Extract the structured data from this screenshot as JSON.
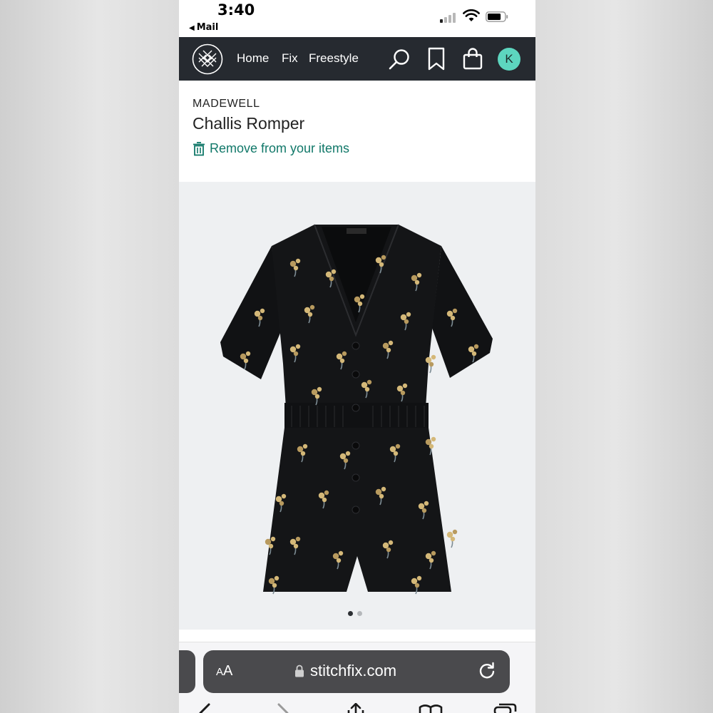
{
  "status_bar": {
    "time": "3:40",
    "back_app": "Mail",
    "cellular_bars_on": 1,
    "cellular_bars_total": 4,
    "battery_level": 0.8
  },
  "nav": {
    "logo_icon": "stitchfix-logo-icon",
    "links": [
      "Home",
      "Fix",
      "Freestyle"
    ],
    "icons": [
      "search-icon",
      "bookmark-icon",
      "bag-icon"
    ],
    "avatar_initial": "K",
    "background_color": "#262a30",
    "avatar_color": "#5dd6bf"
  },
  "product": {
    "brand": "MADEWELL",
    "name": "Challis Romper",
    "remove_label": "Remove from your items",
    "remove_icon": "trash-icon",
    "accent_color": "#117869",
    "image_icon": "romper-product-image",
    "carousel": {
      "current": 1,
      "total": 2
    }
  },
  "browser": {
    "text_size_label": "AA",
    "url": "stitchfix.com",
    "lock_icon": "lock-icon",
    "reload_icon": "reload-icon",
    "toolbar_icons": [
      "back-icon",
      "forward-icon",
      "share-icon",
      "bookmarks-icon",
      "tabs-icon"
    ]
  }
}
